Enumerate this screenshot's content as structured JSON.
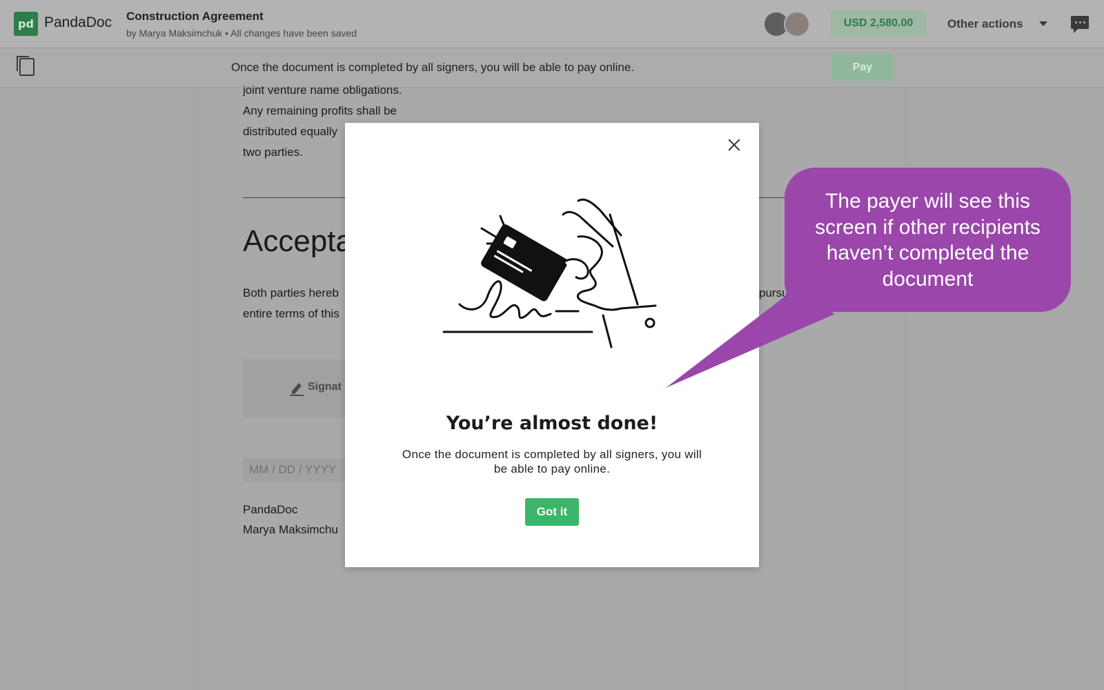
{
  "app": {
    "logo_mark": "pd",
    "name": "PandaDoc"
  },
  "document": {
    "title": "Construction Agreement",
    "subtitle": "by Marya Maksimchuk • All changes have been saved",
    "amount": "USD 2,580.00"
  },
  "header": {
    "other_actions_label": "Other actions"
  },
  "infobar": {
    "message": "Once the document is completed by all signers, you will be able to pay online.",
    "pay_label": "Pay"
  },
  "paper": {
    "lines": [
      "joint venture name obligations.",
      "Any remaining profits shall be",
      "distributed equally",
      "two parties."
    ],
    "acceptance_heading": "Accepta",
    "acceptance_line1_left": "Both parties hereb",
    "acceptance_line1_right": "pursu",
    "acceptance_line2": "entire terms of this",
    "signature_label": "Signat",
    "date_placeholder": "MM / DD / YYYY",
    "company": "PandaDoc",
    "signer": "Marya Maksimchu"
  },
  "modal": {
    "title": "You’re almost done!",
    "body": "Once the document is completed by all signers, you will be able to pay online.",
    "button_label": "Got it"
  },
  "callout": {
    "text": "The payer will see this screen if other recipients haven’t completed the document",
    "color": "#9a46ab"
  },
  "colors": {
    "accent_green": "#3bb56a"
  }
}
